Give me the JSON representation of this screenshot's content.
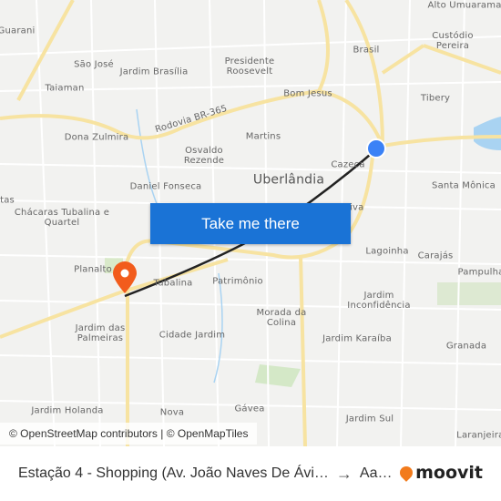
{
  "map": {
    "city_label": "Uberlândia",
    "labels": [
      "Alto Umuarama",
      "Guarani",
      "Brasil",
      "Custódio Pereira",
      "São José",
      "Jardim Brasília",
      "Presidente Roosevelt",
      "Taiaman",
      "Bom Jesus",
      "Tibery",
      "Rodovia BR-365",
      "Dona Zulmira",
      "Martins",
      "Osvaldo Rezende",
      "Cazeca",
      "Daniel Fonseca",
      "Santa Mônica",
      "Chácaras Tubalina e Quartel",
      "Saraiva",
      "Lagoinha",
      "Carajás",
      "Pampulha",
      "Planalto",
      "Tubalina",
      "Patrimônio",
      "Jardim Inconfidência",
      "Morada da Colina",
      "Jardim das Palmeiras",
      "Cidade Jardim",
      "Jardim Karaíba",
      "Granada",
      "Jardim Holanda",
      "Nova",
      "Gávea",
      "Jardim Sul",
      "Laranjeiras",
      "tas"
    ],
    "origin_marker_color": "#3b82f6",
    "destination_marker_color": "#f25c1c",
    "route_color": "#222222"
  },
  "cta": {
    "label": "Take me there"
  },
  "attribution": "© OpenStreetMap contributors | © OpenMapTiles",
  "footer": {
    "from": "Estação 4 - Shopping (Av. João Naves De Ávi…",
    "to": "Aa…",
    "brand": "moovit"
  }
}
